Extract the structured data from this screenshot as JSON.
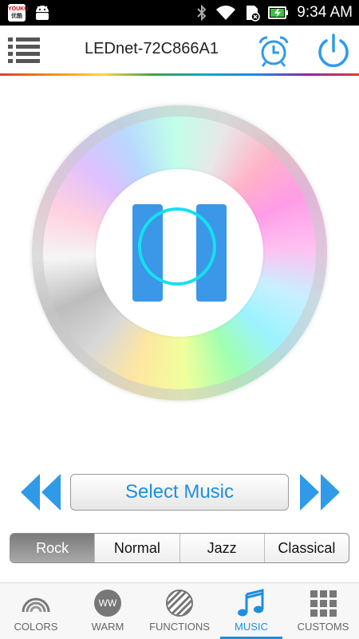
{
  "statusbar": {
    "app_badge_top": "YOUKU",
    "app_badge_bottom": "优酷",
    "time": "9:34 AM"
  },
  "header": {
    "title": "LEDnet-72C866A1"
  },
  "player": {
    "state": "paused"
  },
  "controls": {
    "select_music_label": "Select Music"
  },
  "genres": {
    "items": [
      "Rock",
      "Normal",
      "Jazz",
      "Classical"
    ],
    "selected": "Rock"
  },
  "tabs": {
    "items": [
      {
        "label": "COLORS",
        "icon": "rainbow-icon"
      },
      {
        "label": "WARM",
        "icon": "ww-icon",
        "icon_text": "WW"
      },
      {
        "label": "FUNCTIONS",
        "icon": "striped-circle-icon"
      },
      {
        "label": "MUSIC",
        "icon": "music-note-icon"
      },
      {
        "label": "CUSTOMS",
        "icon": "grid-icon"
      }
    ],
    "selected": "MUSIC"
  },
  "colors": {
    "accent": "#1e8ee0",
    "pause_bars": "#3b97e8",
    "pause_ring": "#16e0ee"
  }
}
